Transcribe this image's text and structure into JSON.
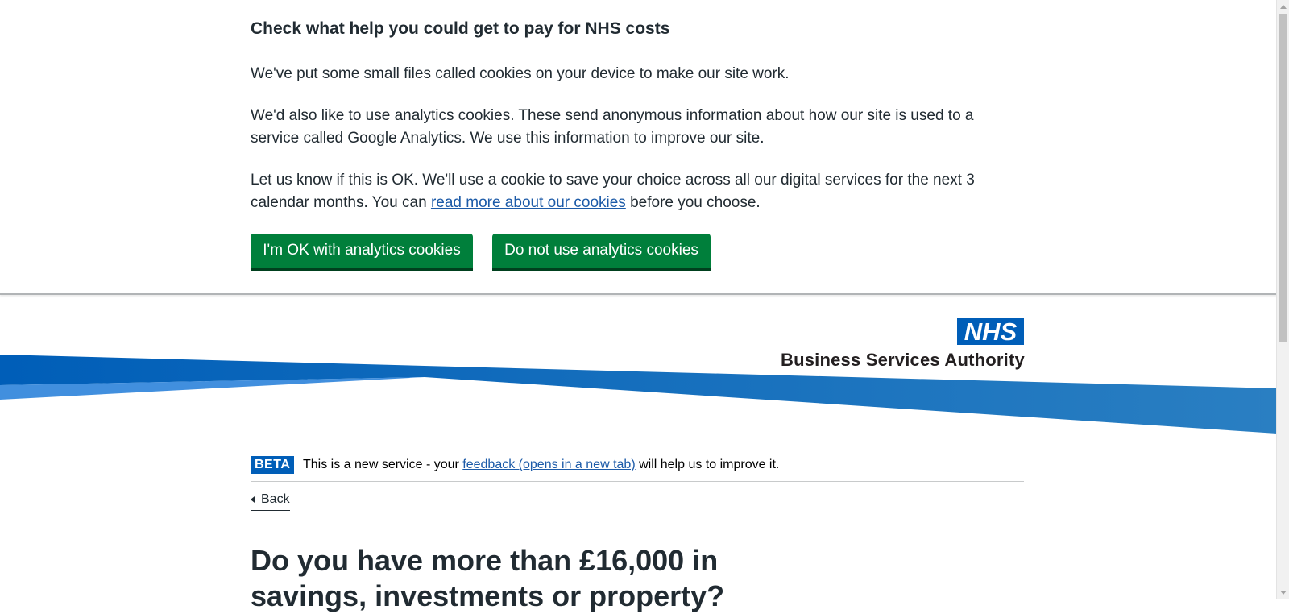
{
  "cookie_banner": {
    "heading": "Check what help you could get to pay for NHS costs",
    "paragraph1": "We've put some small files called cookies on your device to make our site work.",
    "paragraph2": "We'd also like to use analytics cookies. These send anonymous information about how our site is used to a service called Google Analytics. We use this information to improve our site.",
    "paragraph3_before": "Let us know if this is OK. We'll use a cookie to save your choice across all our digital services for the next 3 calendar months. You can ",
    "paragraph3_link": "read more about our cookies",
    "paragraph3_after": " before you choose.",
    "accept_button": "I'm OK with analytics cookies",
    "reject_button": "Do not use analytics cookies"
  },
  "header": {
    "logo_mark": "NHS",
    "logo_text": "Business Services Authority"
  },
  "phase_banner": {
    "tag": "BETA",
    "text_before": "This is a new service - your ",
    "link": "feedback (opens in a new tab)",
    "text_after": " will help us to improve it."
  },
  "back_link": "Back",
  "page_title": "Do you have more than £16,000 in savings, investments or property?",
  "colors": {
    "button_green": "#007f3b",
    "link_blue": "#1d5ba8",
    "nhs_blue": "#005eb8",
    "swoosh_blue": "#1c75bc",
    "swoosh_light": "#418fde"
  },
  "icons": [
    "nhs-logo",
    "back-chevron-icon",
    "scrollbar-up-arrow",
    "scrollbar-down-arrow"
  ]
}
